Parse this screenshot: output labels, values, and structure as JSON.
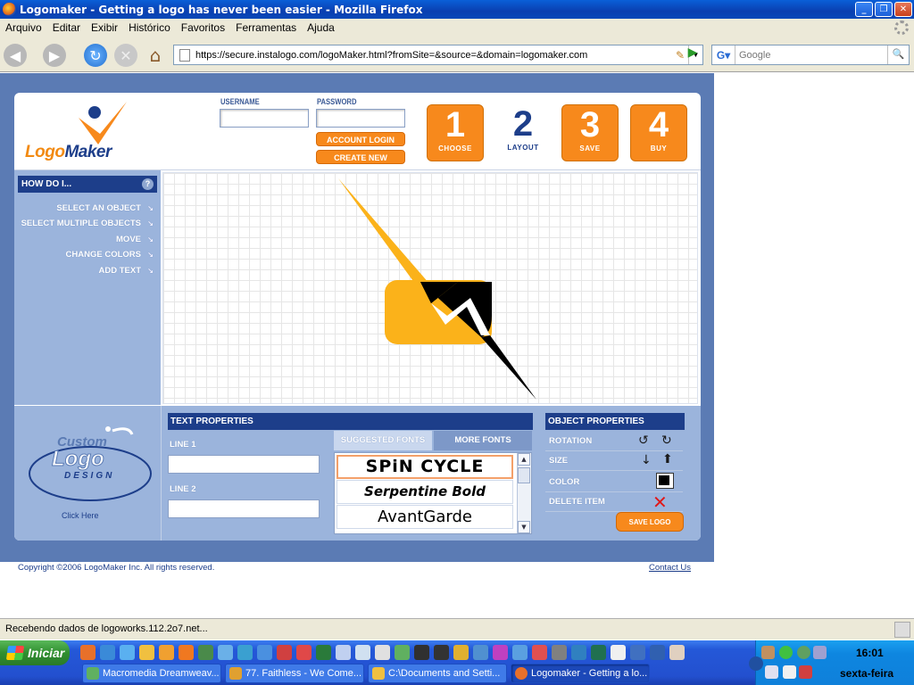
{
  "browser": {
    "title": "Logomaker - Getting a logo has never been easier - Mozilla Firefox",
    "menu": [
      "Arquivo",
      "Editar",
      "Exibir",
      "Histórico",
      "Favoritos",
      "Ferramentas",
      "Ajuda"
    ],
    "url": "https://secure.instalogo.com/logoMaker.html?fromSite=&source=&domain=logomaker.com",
    "search_placeholder": "Google",
    "status": "Recebendo dados de logoworks.112.2o7.net..."
  },
  "page": {
    "brand": {
      "part1": "Logo",
      "part2": "Maker"
    },
    "login": {
      "username_label": "USERNAME",
      "password_label": "PASSWORD",
      "account_login": "ACCOUNT LOGIN",
      "create_account": "CREATE NEW ACCOUNT"
    },
    "steps": [
      {
        "num": "1",
        "label": "CHOOSE"
      },
      {
        "num": "2",
        "label": "LAYOUT"
      },
      {
        "num": "3",
        "label": "SAVE"
      },
      {
        "num": "4",
        "label": "BUY"
      }
    ],
    "howdo": {
      "title": "HOW DO I...",
      "items": [
        "SELECT AN OBJECT",
        "SELECT MULTIPLE OBJECTS",
        "MOVE",
        "CHANGE COLORS",
        "ADD TEXT"
      ]
    },
    "custom_logo": {
      "line1": "Custom",
      "line2": "Logo",
      "line3": "DESIGN",
      "click_here": "Click Here"
    },
    "text_properties": {
      "title": "TEXT PROPERTIES",
      "line1": "LINE 1",
      "line2": "LINE 2",
      "tab_suggested": "SUGGESTED FONTS",
      "tab_more": "MORE FONTS",
      "fonts": [
        "SPiN CYCLE",
        "Serpentine Bold",
        "AvantGarde"
      ]
    },
    "object_properties": {
      "title": "OBJECT PROPERTIES",
      "rotation": "ROTATION",
      "size": "SIZE",
      "color": "COLOR",
      "delete": "DELETE ITEM",
      "save_logo": "SAVE LOGO"
    },
    "footer": {
      "copyright": "Copyright ©2006 LogoMaker Inc. All rights reserved.",
      "contact": "Contact Us"
    },
    "colors": {
      "accent": "#f7891c",
      "navy": "#1d3e8a",
      "panel": "#9bb4dc",
      "logo_yellow": "#fbb21a"
    }
  },
  "taskbar": {
    "start": "Iniciar",
    "tasks": [
      "Macromedia Dreamweav...",
      "77. Faithless - We Come...",
      "C:\\Documents and Setti...",
      "Logomaker - Getting a lo..."
    ],
    "clock": "16:01",
    "day": "sexta-feira"
  }
}
